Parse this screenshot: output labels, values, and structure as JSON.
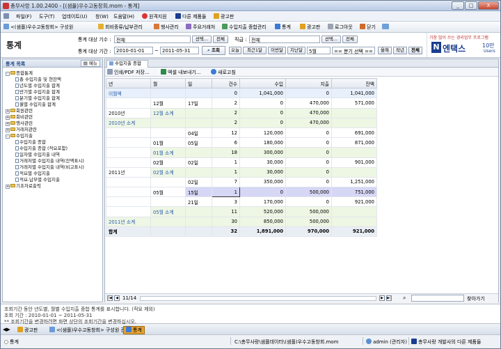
{
  "window": {
    "title": "총무사랑 1.00.2400 - [(샘플)우수고동창회.mom - 통계]",
    "minimize": "_",
    "restore": "□",
    "close": "X"
  },
  "menu": [
    "파일(F)",
    "도구(T)",
    "업데이트(U)",
    "창(W)",
    "도움말(H)",
    "원격지원",
    "다른 제품들",
    "광고판"
  ],
  "toolbar": [
    "<(샘플)우수고동창회> 구성원",
    "회비종류/납부관리",
    "행사관리",
    "주요거래처",
    "수입지출 종합관리",
    "통계",
    "광고판",
    "로그아웃",
    "닫기"
  ],
  "header": {
    "page_title": "통계",
    "label_period_count": "통계 대상 기수 :",
    "value_period_count": "전체",
    "label_position": "직급 :",
    "value_position": "전체",
    "btn_select": "선택...",
    "btn_all": "전체",
    "label_date": "통계 대상 기간 :",
    "date_from": "2010-01-01",
    "date_to": "2011-05-31",
    "tilde": "~",
    "btn_search": "조회",
    "quick": [
      "오늘",
      "최근1달",
      "이번달",
      "지난달"
    ],
    "month_select": "5월",
    "quarter_select": "== 분기 선택 ==",
    "year_btns": [
      "올해",
      "작년",
      "전체"
    ]
  },
  "brand": {
    "tagline": "가장 많이 쓰는 경리업무 프로그램",
    "name": "엔택스",
    "count": "10만",
    "unit": "Users"
  },
  "left_panel": {
    "title": "통계 목록",
    "menu": "메뉴"
  },
  "tree": [
    {
      "label": "종합통계",
      "level": 0,
      "type": "folder",
      "toggle": "-"
    },
    {
      "label": "총 수입지출 및 현잔액",
      "level": 1,
      "type": "doc"
    },
    {
      "label": "년도별 수입지출 합계",
      "level": 1,
      "type": "doc"
    },
    {
      "label": "반기별 수입지출 합계",
      "level": 1,
      "type": "doc"
    },
    {
      "label": "분기별 수입지출 합계",
      "level": 1,
      "type": "doc"
    },
    {
      "label": "월별 수입지출 합계",
      "level": 1,
      "type": "doc"
    },
    {
      "label": "회원관련",
      "level": 0,
      "type": "folder",
      "toggle": "+"
    },
    {
      "label": "회비관련",
      "level": 0,
      "type": "folder",
      "toggle": "+"
    },
    {
      "label": "행사관련",
      "level": 0,
      "type": "folder",
      "toggle": "+"
    },
    {
      "label": "거래처관련",
      "level": 0,
      "type": "folder",
      "toggle": "+"
    },
    {
      "label": "수입지출",
      "level": 0,
      "type": "folder",
      "toggle": "-"
    },
    {
      "label": "수입지출 종합",
      "level": 1,
      "type": "doc"
    },
    {
      "label": "수입지출 종합 (적요포함)",
      "level": 1,
      "type": "doc"
    },
    {
      "label": "일자별 수입지출 내역",
      "level": 1,
      "type": "doc"
    },
    {
      "label": "거래처별 수입지출 내역(잔액표시)",
      "level": 1,
      "type": "doc"
    },
    {
      "label": "거래처별 수입지출 내역(비고표시)",
      "level": 1,
      "type": "doc"
    },
    {
      "label": "적요별 수입지출",
      "level": 1,
      "type": "doc"
    },
    {
      "label": "적요.납부별 수입지출",
      "level": 1,
      "type": "doc"
    },
    {
      "label": "기초자료출력",
      "level": 0,
      "type": "folder",
      "toggle": "+"
    }
  ],
  "tab": "수입지출 종합",
  "actions": {
    "print": "인쇄/PDF 저장...",
    "excel": "엑셀 내보내기...",
    "refresh": "새로고침"
  },
  "table": {
    "headers": [
      "년",
      "월",
      "일",
      "건수",
      "수입",
      "지출",
      "잔액"
    ],
    "rows": [
      {
        "cls": "first",
        "year": "이월액",
        "month": "",
        "day": "",
        "count": "0",
        "income": "1,041,000",
        "expense": "0",
        "balance": "1,041,000"
      },
      {
        "cls": "",
        "year": "",
        "month": "12월",
        "day": "17일",
        "count": "2",
        "income": "0",
        "expense": "470,000",
        "balance": "571,000"
      },
      {
        "cls": "",
        "year": "2010년",
        "month": "12월 소계",
        "day": "",
        "count": "2",
        "income": "0",
        "expense": "470,000",
        "balance": "",
        "monthsub": true
      },
      {
        "cls": "sub",
        "year": "2010년 소계",
        "month": "",
        "day": "",
        "count": "2",
        "income": "0",
        "expense": "470,000",
        "balance": ""
      },
      {
        "cls": "",
        "year": "",
        "month": "",
        "day": "04일",
        "count": "12",
        "income": "120,000",
        "expense": "0",
        "balance": "691,000"
      },
      {
        "cls": "",
        "year": "",
        "month": "01월",
        "day": "05일",
        "count": "6",
        "income": "180,000",
        "expense": "0",
        "balance": "871,000"
      },
      {
        "cls": "",
        "year": "",
        "month": "01월 소계",
        "day": "",
        "count": "18",
        "income": "300,000",
        "expense": "0",
        "balance": "",
        "monthsub": true
      },
      {
        "cls": "",
        "year": "",
        "month": "02월",
        "day": "02일",
        "count": "1",
        "income": "30,000",
        "expense": "0",
        "balance": "901,000"
      },
      {
        "cls": "",
        "year": "2011년",
        "month": "02월 소계",
        "day": "",
        "count": "1",
        "income": "30,000",
        "expense": "0",
        "balance": "",
        "monthsub": true
      },
      {
        "cls": "",
        "year": "",
        "month": "",
        "day": "02일",
        "count": "7",
        "income": "350,000",
        "expense": "0",
        "balance": "1,251,000"
      },
      {
        "cls": "sel",
        "year": "",
        "month": "05월",
        "day": "15일",
        "count": "1",
        "income": "0",
        "expense": "500,000",
        "balance": "751,000"
      },
      {
        "cls": "",
        "year": "",
        "month": "",
        "day": "21일",
        "count": "3",
        "income": "170,000",
        "expense": "0",
        "balance": "921,000"
      },
      {
        "cls": "",
        "year": "",
        "month": "05월 소계",
        "day": "",
        "count": "11",
        "income": "520,000",
        "expense": "500,000",
        "balance": "",
        "monthsub": true
      },
      {
        "cls": "sub",
        "year": "2011년 소계",
        "month": "",
        "day": "",
        "count": "30",
        "income": "850,000",
        "expense": "500,000",
        "balance": ""
      },
      {
        "cls": "total",
        "year": "합계",
        "month": "",
        "day": "",
        "count": "32",
        "income": "1,891,000",
        "expense": "970,000",
        "balance": "921,000"
      }
    ]
  },
  "pager": {
    "page": "11/14",
    "find": "찾아가기"
  },
  "messages": [
    "조회기간 동안 년도별, 월별 수입지출 종합 통계를 표시합니다. (적요 제외)",
    "조회 기간 : 2010-01-01 ~ 2011-05-31",
    "** 조회기간을 변경하려면 화면 상단의 조회기간을 변경하십시오."
  ],
  "taskbar": [
    "광고판",
    "<(샘플)우수고동창회> 구성원 관리",
    "통계"
  ],
  "status": {
    "left": "통계",
    "file": "C:\\총무사랑\\샘플데이터\\(샘플)우수고동창회.mom",
    "user": "admin (관리자)",
    "promo": "총무사랑 개발사의 다른 제품들"
  }
}
